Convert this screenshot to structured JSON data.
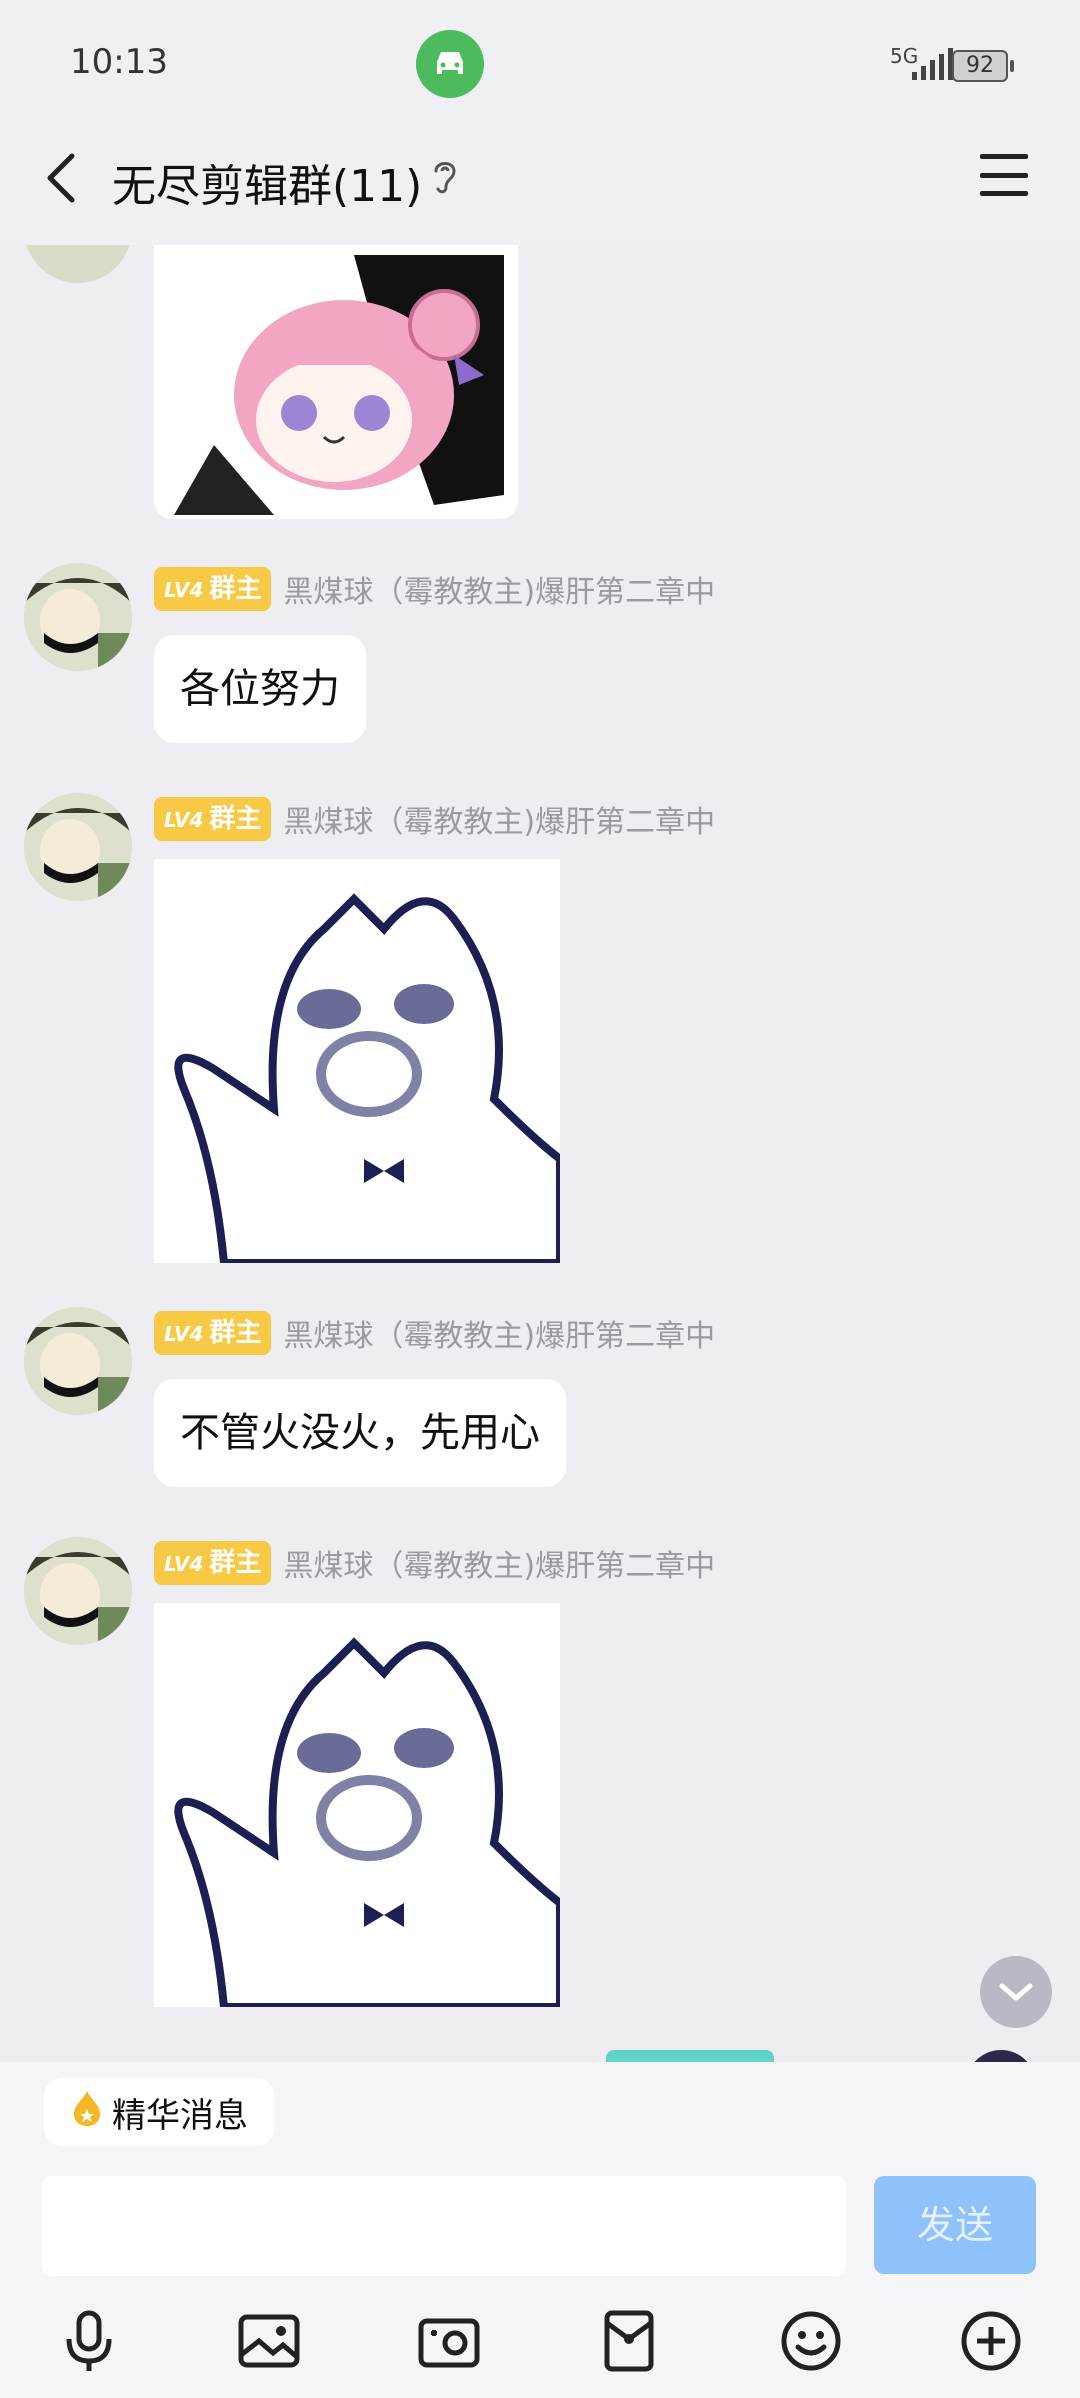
{
  "status_bar": {
    "time": "10:13",
    "signal_label": "5G",
    "battery": "92"
  },
  "header": {
    "title": "无尽剪辑群(11)"
  },
  "messages": [
    {
      "type": "image",
      "sticker": "pink-hair-anime-girl-sticker"
    },
    {
      "type": "text",
      "badge_level": "LV4",
      "badge_role": "群主",
      "sender": "黑煤球（霉教教主)爆肝第二章中",
      "text": "各位努力"
    },
    {
      "type": "image",
      "badge_level": "LV4",
      "badge_role": "群主",
      "sender": "黑煤球（霉教教主)爆肝第二章中",
      "sticker": "blurry-cat-sticker"
    },
    {
      "type": "text",
      "badge_level": "LV4",
      "badge_role": "群主",
      "sender": "黑煤球（霉教教主)爆肝第二章中",
      "text": "不管火没火，先用心"
    },
    {
      "type": "image",
      "badge_level": "LV4",
      "badge_role": "群主",
      "sender": "黑煤球（霉教教主)爆肝第二章中",
      "sticker": "blurry-cat-sticker"
    }
  ],
  "bottom": {
    "essence_label": "精华消息",
    "input_placeholder": "",
    "send_label": "发送",
    "toolbar": [
      "microphone-icon",
      "image-icon",
      "camera-icon",
      "red-packet-icon",
      "emoji-icon",
      "plus-icon"
    ]
  },
  "colors": {
    "background": "#ededf2",
    "badge": "#f7c945",
    "send": "#8fc1fa",
    "status_icon": "#4cbb5d"
  }
}
